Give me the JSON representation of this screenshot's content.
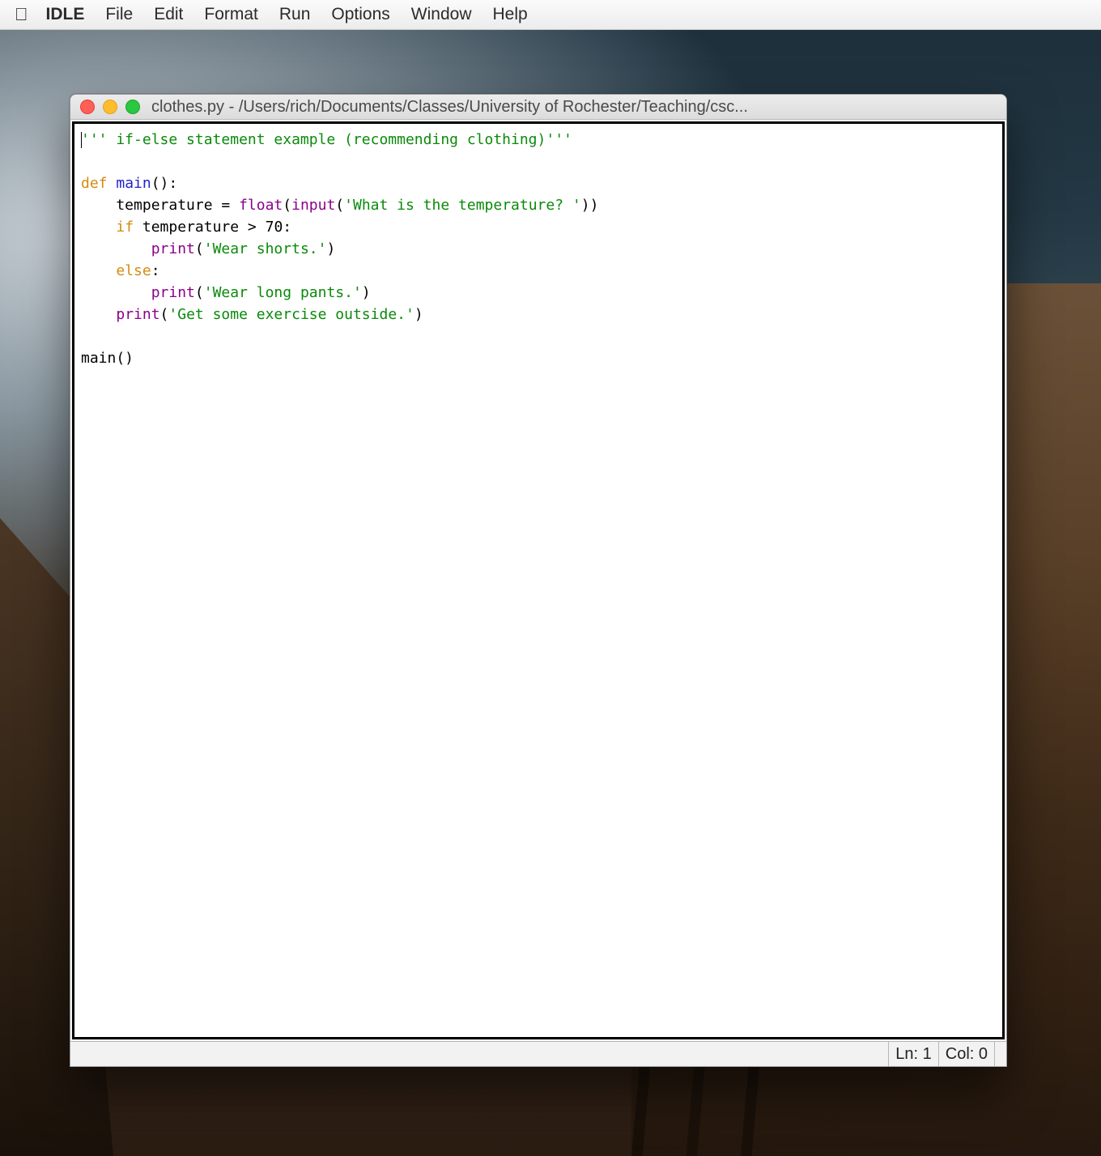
{
  "menubar": {
    "app": "IDLE",
    "items": [
      "File",
      "Edit",
      "Format",
      "Run",
      "Options",
      "Window",
      "Help"
    ]
  },
  "window": {
    "title": "clothes.py - /Users/rich/Documents/Classes/University of Rochester/Teaching/csc..."
  },
  "code": {
    "docstring": "''' if-else statement example (recommending clothing)'''",
    "def_kw": "def",
    "def_name": "main",
    "def_paren": "():",
    "l_assign_pre": "    temperature = ",
    "float_kw": "float",
    "l_assign_mid1": "(",
    "input_kw": "input",
    "l_assign_mid2": "(",
    "prompt_str": "'What is the temperature? '",
    "l_assign_post": "))",
    "if_kw": "if",
    "if_cond": " temperature > 70:",
    "print_kw": "print",
    "shorts_str": "'Wear shorts.'",
    "else_kw": "else",
    "pants_str": "'Wear long pants.'",
    "exercise_str": "'Get some exercise outside.'",
    "call": "main()",
    "indent1": "    ",
    "indent2": "        ",
    "colon": ":",
    "open_p": "(",
    "close_p": ")"
  },
  "status": {
    "ln": "Ln: 1",
    "col": "Col: 0"
  },
  "colors": {
    "string": "#0a8a0a",
    "keyword": "#d38b12",
    "funcname": "#2222cc",
    "builtin": "#8b008b"
  }
}
